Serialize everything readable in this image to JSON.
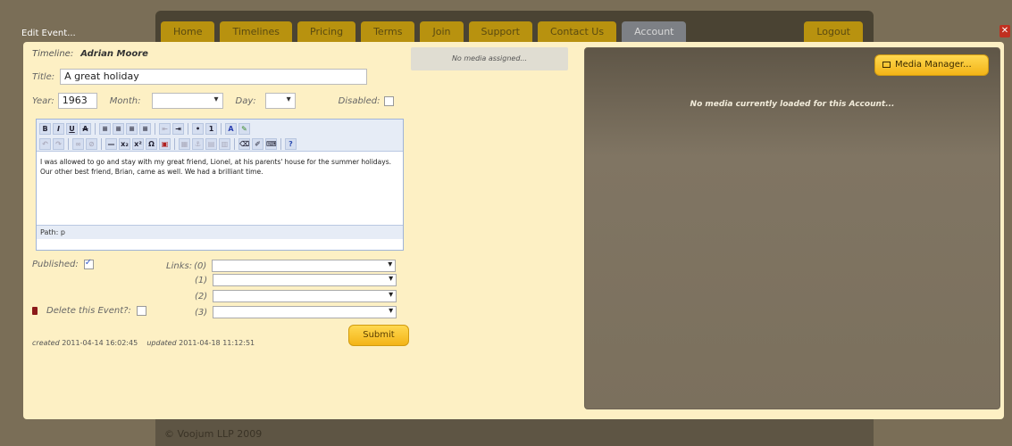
{
  "nav": {
    "tabs": [
      {
        "label": "Home"
      },
      {
        "label": "Timelines"
      },
      {
        "label": "Pricing"
      },
      {
        "label": "Terms"
      },
      {
        "label": "Join"
      },
      {
        "label": "Support"
      },
      {
        "label": "Contact Us"
      },
      {
        "label": "Account"
      }
    ],
    "logout": "Logout",
    "active_tab": "Account",
    "colors": {
      "tab": "#b8920f",
      "active": "#7d8085"
    }
  },
  "footer": {
    "text": "© Voojum LLP 2009"
  },
  "dialog": {
    "title": "Edit Event...",
    "close_icon": "close-icon"
  },
  "form": {
    "timeline_label": "Timeline:",
    "timeline_value": "Adrian Moore",
    "title_label": "Title:",
    "title_value": "A great holiday",
    "year_label": "Year:",
    "year_value": "1963",
    "month_label": "Month:",
    "month_value": "",
    "day_label": "Day:",
    "day_value": "",
    "disabled_label": "Disabled:",
    "editor_content": "I was allowed to go and stay with my great friend, Lionel, at his parents' house for the summer holidays. Our other best friend, Brian, came as well. We had a brilliant time.",
    "editor_path": "Path: p",
    "published_label": "Published:",
    "delete_label": "Delete this Event?:",
    "links_label": "Links:",
    "link_indices": [
      "(0)",
      "(1)",
      "(2)",
      "(3)"
    ],
    "submit_label": "Submit",
    "created_label": "created",
    "created_value": "2011-04-14 16:02:45",
    "updated_label": "updated",
    "updated_value": "2011-04-18 11:12:51"
  },
  "media": {
    "strip_text": "No media assigned...",
    "manager_button": "Media Manager...",
    "panel_message": "No media currently loaded for this Account..."
  }
}
